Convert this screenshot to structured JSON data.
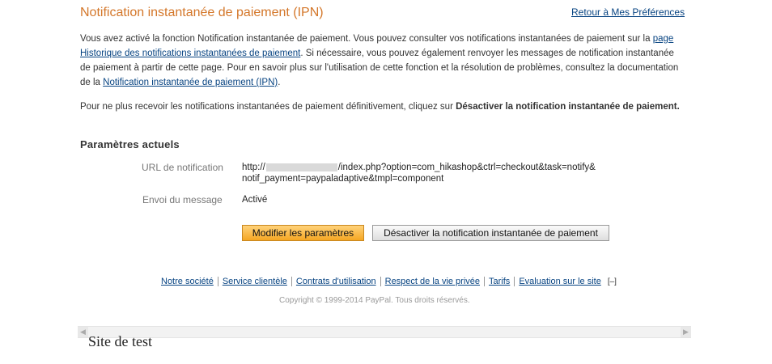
{
  "header": {
    "title": "Notification instantanée de paiement (IPN)",
    "back_link": "Retour à Mes Préférences"
  },
  "intro": {
    "part1": "Vous avez activé la fonction Notification instantanée de paiement. Vous pouvez consulter vos notifications instantanées de paiement sur la ",
    "history_link": "page Historique des notifications instantanées de paiement",
    "part2": ". Si nécessaire, vous pouvez également renvoyer les messages de notification instantanée de paiement à partir de cette page. Pour en savoir plus sur l'utilisation de cette fonction et la résolution de problèmes, consultez la documentation de la ",
    "doc_link": "Notification instantanée de paiement (IPN)",
    "part3": "."
  },
  "disable_note": {
    "text": "Pour ne plus recevoir les notifications instantanées de paiement définitivement, cliquez sur ",
    "bold": "Désactiver la notification instantanée de paiement",
    "end": "."
  },
  "settings": {
    "heading": "Paramètres actuels",
    "url_label": "URL de notification",
    "url_prefix": "http://",
    "url_suffix_line1": "/index.php?option=com_hikashop&ctrl=checkout&task=notify&",
    "url_suffix_line2": "notif_payment=paypaladaptive&tmpl=component",
    "send_label": "Envoi du message",
    "send_value": "Activé"
  },
  "buttons": {
    "modify": "Modifier les paramètres",
    "disable": "Désactiver la notification instantanée de paiement"
  },
  "footer": {
    "links": [
      "Notre société",
      "Service clientèle",
      "Contrats d'utilisation",
      "Respect de la vie privée",
      "Tarifs",
      "Evaluation sur le site"
    ],
    "collapse": "[–]",
    "copyright": "Copyright © 1999-2014 PayPal. Tous droits réservés."
  },
  "scrollbar": {
    "left_arrow": "◀",
    "right_arrow": "▶"
  },
  "site": {
    "name": "Site de test"
  },
  "colors": {
    "title": "#d4772a",
    "link": "#084482",
    "primary_button": "#f5a623"
  }
}
